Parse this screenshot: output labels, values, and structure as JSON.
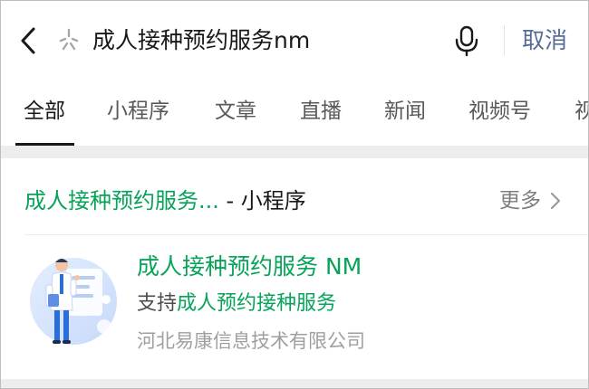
{
  "search": {
    "query": "成人接种预约服务nm",
    "cancel_label": "取消"
  },
  "tabs": [
    {
      "label": "全部",
      "active": true
    },
    {
      "label": "小程序"
    },
    {
      "label": "文章"
    },
    {
      "label": "直播"
    },
    {
      "label": "新闻"
    },
    {
      "label": "视频号"
    },
    {
      "label": "视"
    }
  ],
  "section": {
    "title_highlight": "成人接种预约服务...",
    "title_suffix": " - 小程序",
    "more_label": "更多"
  },
  "result": {
    "name": "成人接种预约服务 NM",
    "desc_prefix": "支持",
    "desc_highlight": "成人预约接种服务",
    "org": "河北易康信息技术有限公司"
  },
  "colors": {
    "highlight": "#07a358",
    "link": "#576b95",
    "secondary_text": "#9f9f9f"
  },
  "icons": {
    "back": "chevron-left-icon",
    "spark": "spark-icon",
    "mic": "microphone-icon",
    "more": "chevron-right-icon",
    "thumb": "doctor-illustration"
  }
}
